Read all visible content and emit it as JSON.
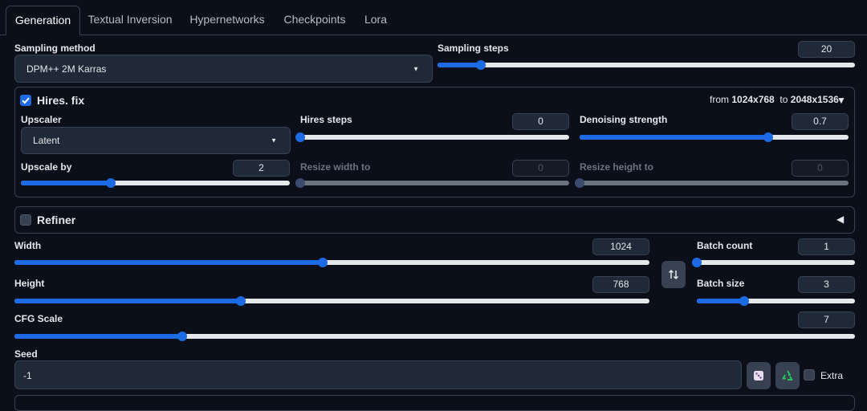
{
  "tabs": [
    "Generation",
    "Textual Inversion",
    "Hypernetworks",
    "Checkpoints",
    "Lora"
  ],
  "sampling_method": {
    "label": "Sampling method",
    "value": "DPM++ 2M Karras"
  },
  "sampling_steps": {
    "label": "Sampling steps",
    "value": "20",
    "fraction": 0.104
  },
  "hires": {
    "label": "Hires. fix",
    "checked": true,
    "from_prefix": "from",
    "from_size": "1024x768",
    "to_prefix": "to",
    "to_size": "2048x1536",
    "upscaler": {
      "label": "Upscaler",
      "value": "Latent"
    },
    "hires_steps": {
      "label": "Hires steps",
      "value": "0",
      "fraction": 0.0
    },
    "denoising": {
      "label": "Denoising strength",
      "value": "0.7",
      "fraction": 0.7
    },
    "upscale_by": {
      "label": "Upscale by",
      "value": "2",
      "fraction": 0.333
    },
    "resize_width": {
      "label": "Resize width to",
      "value": "0",
      "fraction": 0.0
    },
    "resize_height": {
      "label": "Resize height to",
      "value": "0",
      "fraction": 0.0
    }
  },
  "refiner": {
    "label": "Refiner",
    "checked": false
  },
  "width": {
    "label": "Width",
    "value": "1024",
    "fraction": 0.485
  },
  "height": {
    "label": "Height",
    "value": "768",
    "fraction": 0.357
  },
  "batch_count": {
    "label": "Batch count",
    "value": "1",
    "fraction": 0.0
  },
  "batch_size": {
    "label": "Batch size",
    "value": "3",
    "fraction": 0.3
  },
  "cfg_scale": {
    "label": "CFG Scale",
    "value": "7",
    "fraction": 0.2
  },
  "seed": {
    "label": "Seed",
    "value": "-1",
    "extra_label": "Extra"
  },
  "icons": {
    "swap": "swap-dimensions-icon",
    "dice": "dice-icon",
    "recycle": "recycle-icon"
  },
  "colors": {
    "accent": "#1d6ae5",
    "background": "#0b0f19",
    "panel": "#1f2937"
  }
}
